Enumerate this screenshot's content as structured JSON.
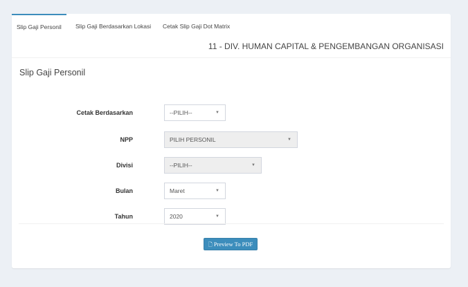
{
  "tabs": [
    {
      "label": "Slip Gaji Personil"
    },
    {
      "label": "Slip Gaji Berdasarkan Lokasi"
    },
    {
      "label": "Cetak Slip Gaji Dot Matrix"
    }
  ],
  "division": "11 - DIV. HUMAN CAPITAL & PENGEMBANGAN ORGANISASI",
  "form": {
    "title": "Slip Gaji Personil",
    "fields": [
      {
        "label": "Cetak Berdasarkan",
        "value": "--PILIH--",
        "disabled": false
      },
      {
        "label": "NPP",
        "value": "PILIH PERSONIL",
        "disabled": true
      },
      {
        "label": "Divisi",
        "value": "--PILIH--",
        "disabled": true
      },
      {
        "label": "Bulan",
        "value": "Maret",
        "disabled": false
      },
      {
        "label": "Tahun",
        "value": "2020",
        "disabled": false
      }
    ],
    "preview_button": "Preview To PDF",
    "caret_glyph": "▼",
    "pdf_icon_glyph": "🗋"
  },
  "colors": {
    "accent": "#3c8dbc",
    "background": "#ecf0f5"
  }
}
